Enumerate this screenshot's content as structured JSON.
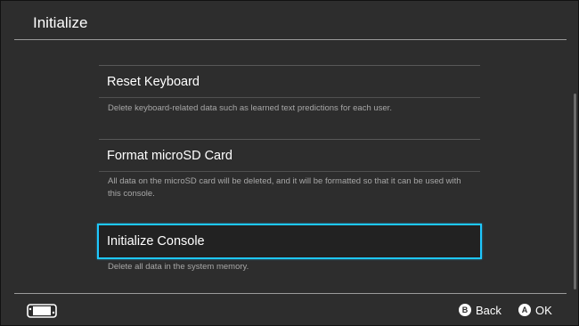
{
  "header": {
    "title": "Initialize"
  },
  "items": [
    {
      "label": "Reset Keyboard",
      "description": "Delete keyboard-related data such as learned text predictions for each user."
    },
    {
      "label": "Format microSD Card",
      "description": "All data on the microSD card will be deleted, and it will be formatted so that it can be used with this console."
    },
    {
      "label": "Initialize Console",
      "description": "Delete all data in the system memory."
    }
  ],
  "footer": {
    "back": {
      "button_glyph": "B",
      "label": "Back"
    },
    "ok": {
      "button_glyph": "A",
      "label": "OK"
    },
    "device_icon": "switch-console-icon"
  },
  "colors": {
    "background": "#2d2d2d",
    "selection_border": "#1ec8ff",
    "description_text": "#a7a7a7"
  }
}
